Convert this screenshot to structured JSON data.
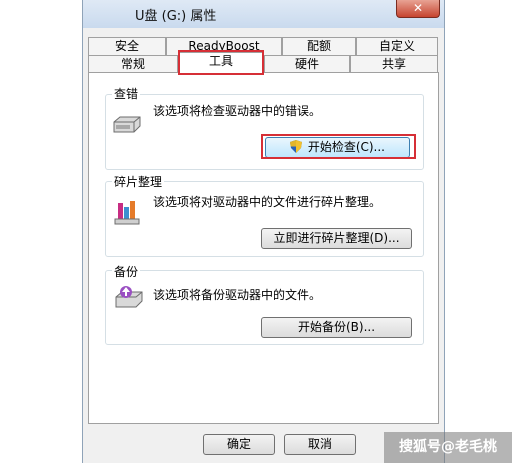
{
  "window": {
    "title": "U盘 (G:) 属性",
    "close_symbol": "✕"
  },
  "tabs": {
    "row1": [
      "安全",
      "ReadyBoost",
      "配额",
      "自定义"
    ],
    "row2": [
      "常规",
      "工具",
      "硬件",
      "共享"
    ],
    "active": "工具"
  },
  "error_check": {
    "label": "查错",
    "description": "该选项将检查驱动器中的错误。",
    "button_label": "开始检查(C)..."
  },
  "defrag": {
    "label": "碎片整理",
    "description": "该选项将对驱动器中的文件进行碎片整理。",
    "button_label": "立即进行碎片整理(D)..."
  },
  "backup": {
    "label": "备份",
    "description": "该选项将备份驱动器中的文件。",
    "button_label": "开始备份(B)..."
  },
  "footer": {
    "ok_label": "确定",
    "cancel_label": "取消"
  },
  "watermark": "搜狐号@老毛桃",
  "colors": {
    "highlight": "#d62f36",
    "button_focus": "#bee6fd"
  }
}
